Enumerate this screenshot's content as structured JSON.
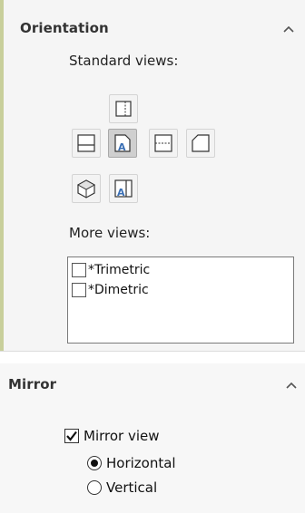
{
  "orientation": {
    "title": "Orientation",
    "standard_views_label": "Standard views:",
    "more_views_label": "More views:",
    "standard_views": [
      {
        "name": "top",
        "icon": "top-view-icon"
      },
      {
        "name": "left",
        "icon": "left-view-icon"
      },
      {
        "name": "front",
        "icon": "front-view-icon",
        "selected": true
      },
      {
        "name": "right",
        "icon": "right-view-icon"
      },
      {
        "name": "back",
        "icon": "back-view-icon"
      },
      {
        "name": "isometric",
        "icon": "isometric-view-icon"
      },
      {
        "name": "bottom",
        "icon": "bottom-view-icon"
      }
    ],
    "more_views": [
      {
        "label": "*Trimetric",
        "checked": false
      },
      {
        "label": "*Dimetric",
        "checked": false
      }
    ]
  },
  "mirror": {
    "title": "Mirror",
    "mirror_view_label": "Mirror view",
    "mirror_view_checked": true,
    "options": [
      {
        "label": "Horizontal",
        "selected": true
      },
      {
        "label": "Vertical",
        "selected": false
      }
    ]
  },
  "colors": {
    "accent_bar": "#c8cf9b",
    "selected_button": "#cfcfcf",
    "icon_blue": "#3a6fb5"
  }
}
